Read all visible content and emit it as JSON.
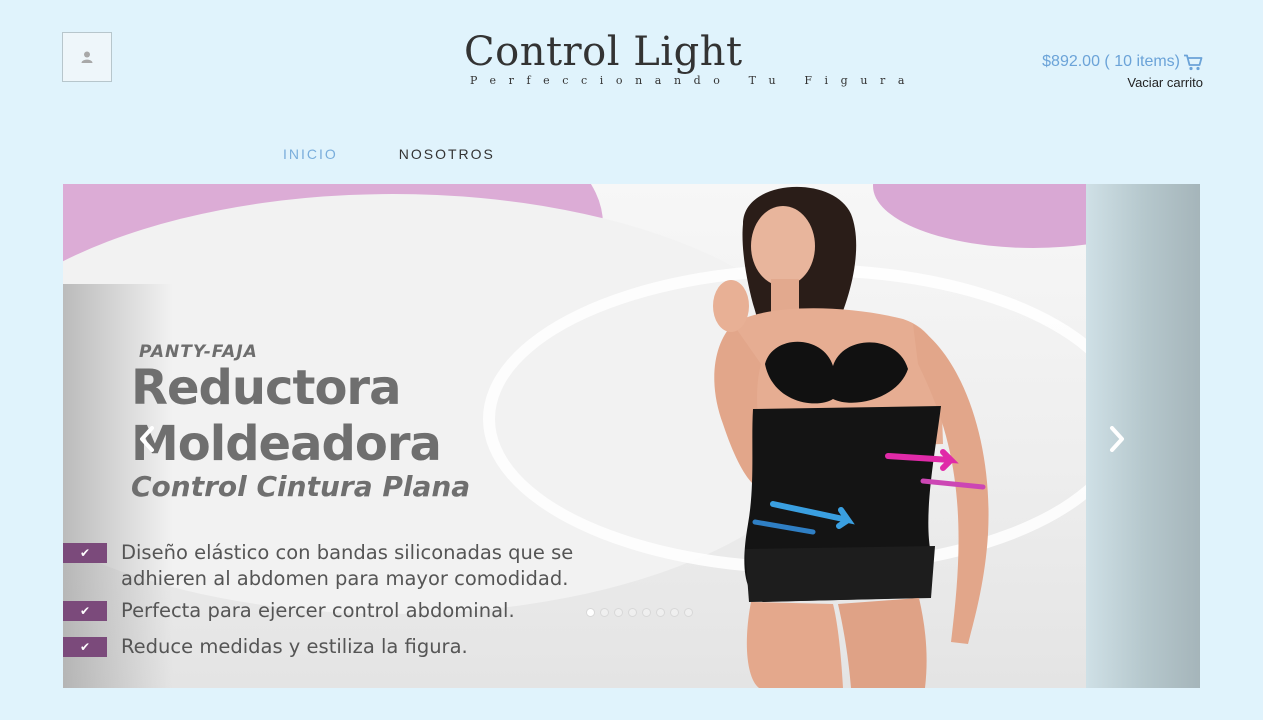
{
  "header": {
    "title": "Control Light",
    "tagline": "Perfeccionando Tu Figura"
  },
  "account": {
    "icon": "user-icon"
  },
  "cart": {
    "total": "$892.00 ( 10 items)",
    "empty_label": "Vaciar carrito",
    "icon": "cart-icon",
    "link_color": "#6ba3d8"
  },
  "nav": {
    "items": [
      {
        "label": "INICIO",
        "active": true
      },
      {
        "label": "NOSOTROS",
        "active": false
      }
    ]
  },
  "slider": {
    "slide": {
      "eyebrow": "PANTY-FAJA",
      "title_line1": "Reductora",
      "title_line2": "Moldeadora",
      "subtitle": "Control Cintura Plana",
      "features": [
        "Diseño elástico con bandas siliconadas que se\nadhieren al abdomen para mayor comodidad.",
        "Perfecta para ejercer control abdominal.",
        "Reduce medidas y estiliza la figura."
      ]
    },
    "dot_count": 8,
    "active_dot": 0,
    "prev_icon": "chevron-left-icon",
    "next_icon": "chevron-right-icon"
  },
  "colors": {
    "background": "#e0f3fc",
    "accent": "#7aaedc",
    "slide_purple": "#dcacd6",
    "check_box": "#7b4a7b"
  }
}
